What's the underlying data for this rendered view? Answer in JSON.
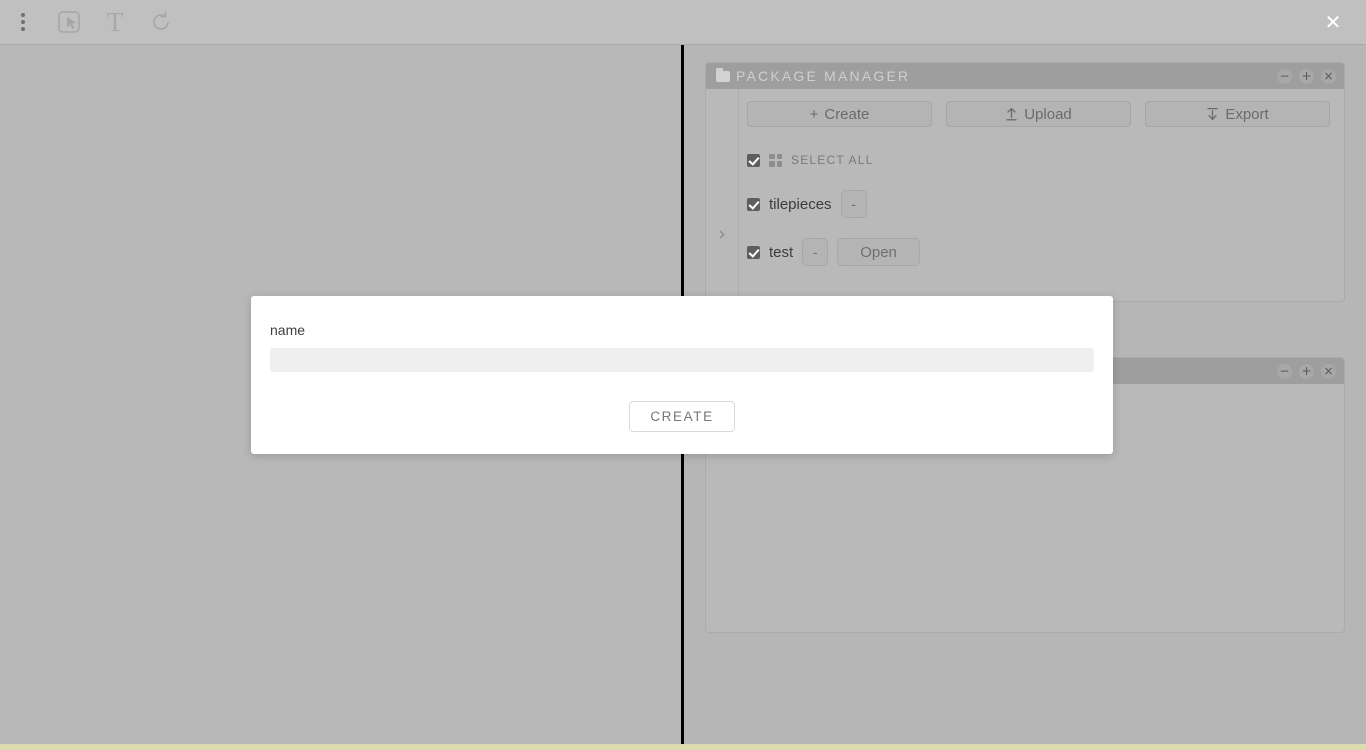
{
  "toolbar": {
    "menu_icon": "more-vertical-icon",
    "select_tool_icon": "select-cursor-icon",
    "text_tool_icon": "text-tool-icon",
    "text_tool_label": "T",
    "refresh_tool_icon": "refresh-icon",
    "close_label": "✕"
  },
  "panels": [
    {
      "title": "PACKAGE MANAGER",
      "icon": "folder-icon",
      "controls": {
        "minimize": "−",
        "maximize": "+",
        "close": "×"
      },
      "expand_chevron": "›",
      "buttons": [
        {
          "label": "Create",
          "prefix": "+",
          "icon": "plus-icon"
        },
        {
          "label": "Upload",
          "icon": "upload-arrow-icon"
        },
        {
          "label": "Export",
          "icon": "download-arrow-icon"
        }
      ],
      "select_all": {
        "label": "SELECT ALL",
        "checked": true,
        "grid_icon": "grid-icon"
      },
      "items": [
        {
          "name": "tilepieces",
          "checked": true,
          "actions": [
            {
              "label": "-",
              "name": "collapse-button"
            }
          ]
        },
        {
          "name": "test",
          "checked": true,
          "actions": [
            {
              "label": "-",
              "name": "collapse-button"
            },
            {
              "label": "Open",
              "name": "open-button"
            }
          ]
        }
      ]
    },
    {
      "title": "",
      "controls": {
        "minimize": "−",
        "maximize": "+",
        "close": "×"
      }
    }
  ],
  "modal": {
    "label": "name",
    "input_value": "",
    "input_placeholder": "",
    "create_label": "CREATE"
  },
  "colors": {
    "app_background": "#b6b6b6",
    "toolbar_background": "#c0c0c0",
    "panel_background": "#b9b9b9",
    "panel_header": "#9e9e9e",
    "divider": "#000000",
    "bottom_strip": "#dcdcae",
    "modal_background": "#ffffff",
    "checkbox": "#5e5e5e"
  }
}
